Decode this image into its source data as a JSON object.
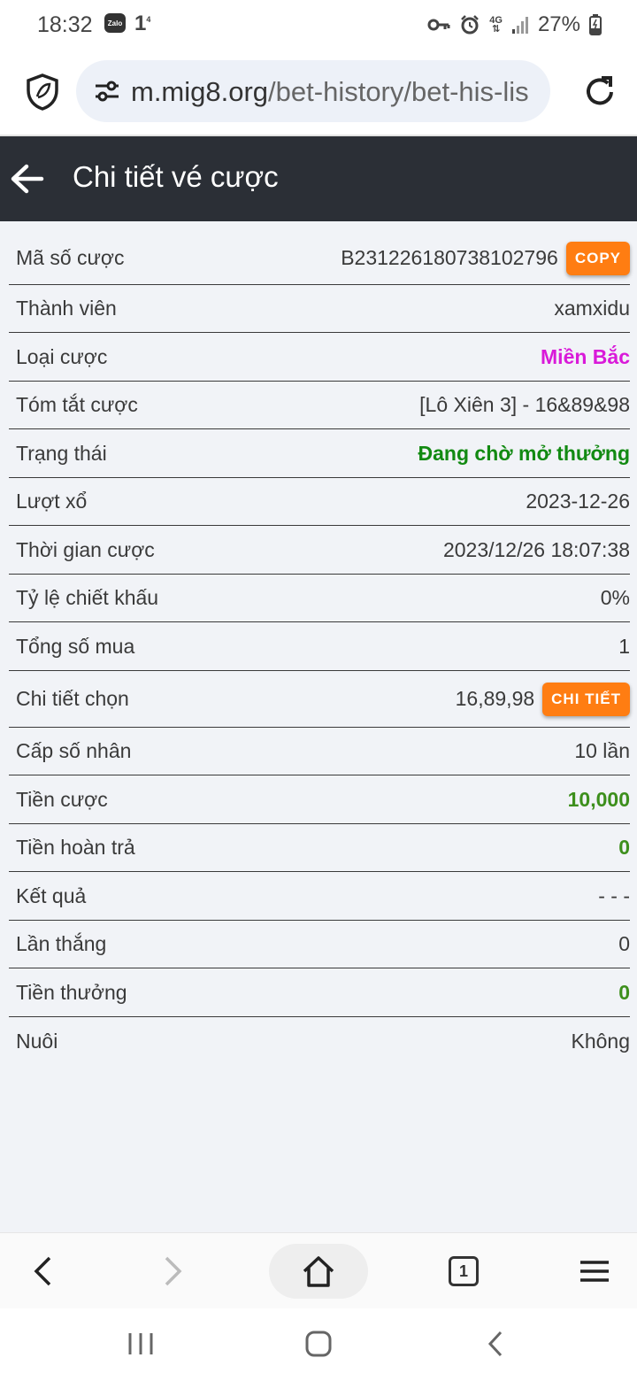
{
  "status_bar": {
    "time": "18:32",
    "zalo_label": "Zalo",
    "notif_count": "1",
    "notif_sup": "4",
    "network": "4G",
    "battery": "27%"
  },
  "browser": {
    "url_host": "m.mig8.org",
    "url_path": "/bet-history/bet-his-lis"
  },
  "header": {
    "title": "Chi tiết vé cược"
  },
  "details": [
    {
      "label": "Mã số cược",
      "value": "B231226180738102796",
      "button": "COPY"
    },
    {
      "label": "Thành viên",
      "value": "xamxidu"
    },
    {
      "label": "Loại cược",
      "value": "Miền Bắc"
    },
    {
      "label": "Tóm tắt cược",
      "value": "[Lô Xiên 3] - 16&89&98"
    },
    {
      "label": "Trạng thái",
      "value": "Đang chờ mở thưởng"
    },
    {
      "label": "Lượt xổ",
      "value": "2023-12-26"
    },
    {
      "label": "Thời gian cược",
      "value": "2023/12/26 18:07:38"
    },
    {
      "label": "Tỷ lệ chiết khấu",
      "value": "0%"
    },
    {
      "label": "Tổng số mua",
      "value": "1"
    },
    {
      "label": "Chi tiết chọn",
      "value": "16,89,98",
      "button": "CHI TIẾT"
    },
    {
      "label": "Cấp số nhân",
      "value": "10 lần"
    },
    {
      "label": "Tiền cược",
      "value": "10,000"
    },
    {
      "label": "Tiền hoàn trả",
      "value": "0"
    },
    {
      "label": "Kết quả",
      "value": "- - -"
    },
    {
      "label": "Lần thắng",
      "value": "0"
    },
    {
      "label": "Tiền thưởng",
      "value": "0"
    },
    {
      "label": "Nuôi",
      "value": "Không"
    }
  ],
  "bottom_bar": {
    "tab_count": "1"
  },
  "colors": {
    "header_bg": "#2b2f36",
    "accent_orange": "#ff7d12",
    "magenta": "#d91ad9",
    "status_green": "#128a12",
    "amount_green": "#3d8f1c"
  }
}
